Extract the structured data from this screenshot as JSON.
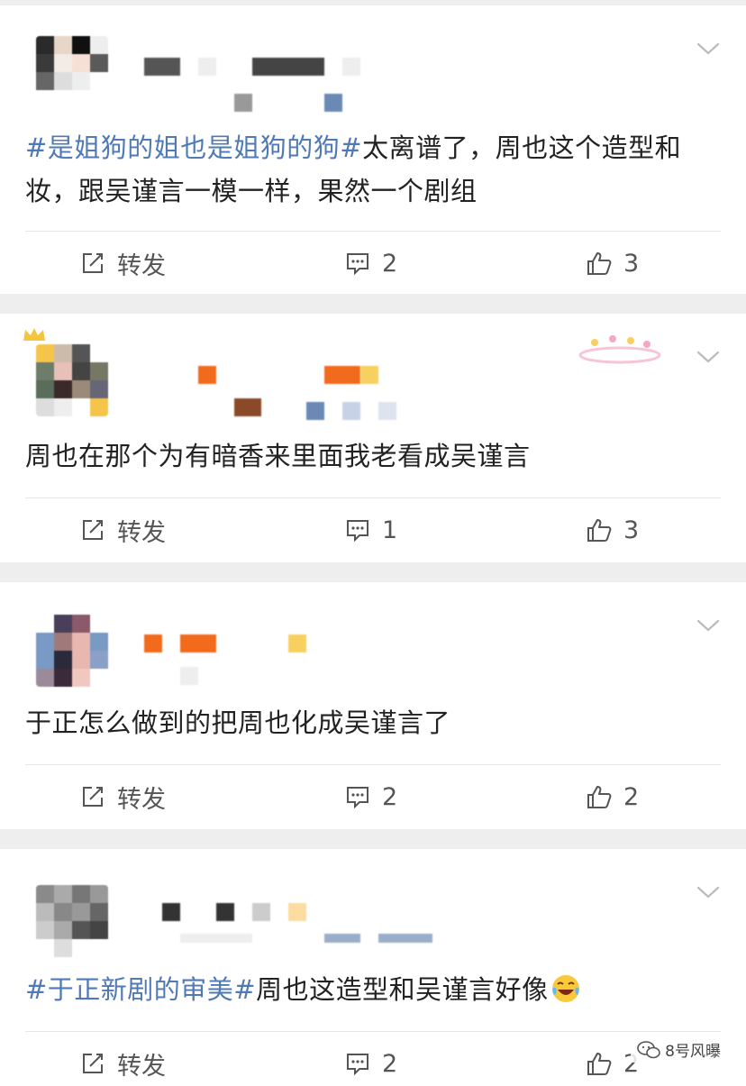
{
  "labels": {
    "share": "转发"
  },
  "watermark": {
    "text": "8号风曝"
  },
  "posts": [
    {
      "hashtag": "#是姐狗的姐也是姐狗的狗#",
      "text": "太离谱了，周也这个造型和妆，跟吴谨言一模一样，果然一个剧组",
      "comments": "2",
      "likes": "3"
    },
    {
      "hashtag": "",
      "text": "周也在那个为有暗香来里面我老看成吴谨言",
      "comments": "1",
      "likes": "3"
    },
    {
      "hashtag": "",
      "text": "于正怎么做到的把周也化成吴谨言了",
      "comments": "2",
      "likes": "2"
    },
    {
      "hashtag": "#于正新剧的审美#",
      "text": "周也这造型和吴谨言好像",
      "comments": "2",
      "likes": "2"
    }
  ],
  "colors": {
    "hashtag": "#4f7ab5",
    "text": "#222222",
    "action": "#555555"
  },
  "icons": {
    "share": "edit-share-icon",
    "comment": "comment-bubble-icon",
    "like": "thumbs-up-icon",
    "more": "chevron-down-icon",
    "emoji": "laughing-tears-emoji"
  }
}
